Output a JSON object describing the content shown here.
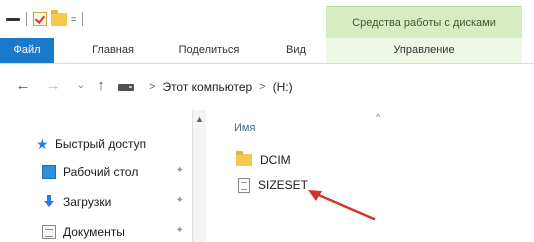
{
  "titlebar": {
    "qat_dropdown": "="
  },
  "ribbon": {
    "context_group_label": "Средства работы с дисками",
    "tabs": {
      "file": "Файл",
      "home": "Главная",
      "share": "Поделиться",
      "view": "Вид",
      "manage": "Управление"
    }
  },
  "address_bar": {
    "crumbs": [
      "Этот компьютер",
      "(H:)"
    ],
    "separator": ">"
  },
  "nav_pane": {
    "items": [
      {
        "label": "Быстрый доступ",
        "icon": "star-icon"
      },
      {
        "label": "Рабочий стол",
        "icon": "desktop-icon",
        "pinned": true
      },
      {
        "label": "Загрузки",
        "icon": "download-icon",
        "pinned": true
      },
      {
        "label": "Документы",
        "icon": "documents-icon",
        "pinned": true
      }
    ]
  },
  "content": {
    "column_name": "Имя",
    "files": [
      {
        "name": "DCIM",
        "icon": "folder-icon"
      },
      {
        "name": "SIZESET",
        "icon": "file-icon"
      }
    ]
  },
  "colors": {
    "file_tab": "#1979ca",
    "context_tab": "#d8ecc4",
    "annotation_arrow": "#d0342c"
  }
}
